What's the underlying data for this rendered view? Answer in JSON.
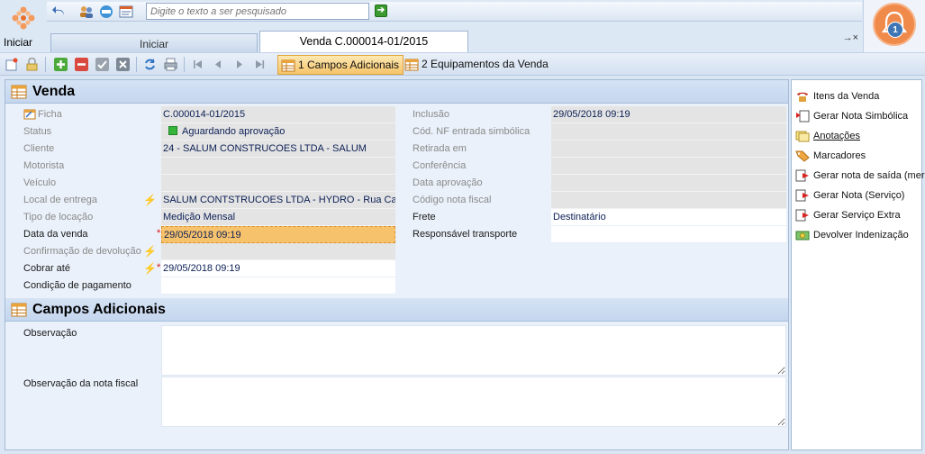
{
  "start": {
    "label": "Iniciar"
  },
  "search": {
    "placeholder": "Digite o texto a ser pesquisado"
  },
  "tabs": [
    {
      "label": "Iniciar"
    },
    {
      "label": "Venda C.000014-01/2015"
    }
  ],
  "tab_close": "→×",
  "notifications": {
    "count": "1"
  },
  "toolbar": {
    "tab1_label": "1 Campos Adicionais",
    "tab2_label": "2 Equipamentos da Venda"
  },
  "venda": {
    "title": "Venda",
    "left": [
      {
        "label": "Ficha",
        "value": "C.000014-01/2015"
      },
      {
        "label": "Status",
        "value": "Aguardando aprovação"
      },
      {
        "label": "Cliente",
        "value": "24 - SALUM CONSTRUCOES LTDA - SALUM"
      },
      {
        "label": "Motorista",
        "value": ""
      },
      {
        "label": "Veículo",
        "value": ""
      },
      {
        "label": "Local de entrega",
        "value": "SALUM CONTSTRUCOES LTDA - HYDRO - Rua Castelo"
      },
      {
        "label": "Tipo de locação",
        "value": "Medição Mensal"
      },
      {
        "label": "Data da venda",
        "value": "29/05/2018 09:19"
      },
      {
        "label": "Confirmação de devolução",
        "value": ""
      },
      {
        "label": "Cobrar até",
        "value": "29/05/2018 09:19"
      },
      {
        "label": "Condição de pagamento",
        "value": ""
      }
    ],
    "right": [
      {
        "label": "Inclusão",
        "value": "29/05/2018 09:19"
      },
      {
        "label": "Cód. NF entrada simbólica",
        "value": ""
      },
      {
        "label": "Retirada em",
        "value": ""
      },
      {
        "label": "Conferência",
        "value": ""
      },
      {
        "label": "Data aprovação",
        "value": ""
      },
      {
        "label": "Código nota fiscal",
        "value": ""
      },
      {
        "label": "Frete",
        "value": "Destinatário"
      },
      {
        "label": "Responsável transporte",
        "value": ""
      }
    ]
  },
  "campos": {
    "title": "Campos Adicionais",
    "observacao": "Observação",
    "observacao_nf": "Observação da nota fiscal"
  },
  "actions": [
    {
      "label": "Itens da Venda"
    },
    {
      "label": "Gerar Nota Simbólica"
    },
    {
      "label": "Anotações"
    },
    {
      "label": "Marcadores"
    },
    {
      "label": "Gerar nota de saída (mer"
    },
    {
      "label": "Gerar Nota (Serviço)"
    },
    {
      "label": "Gerar Serviço Extra"
    },
    {
      "label": "Devolver Indenização"
    }
  ],
  "colors": {
    "accent_orange": "#f7c26c",
    "notif": "#f08a4b",
    "status_green": "#35b53a"
  }
}
